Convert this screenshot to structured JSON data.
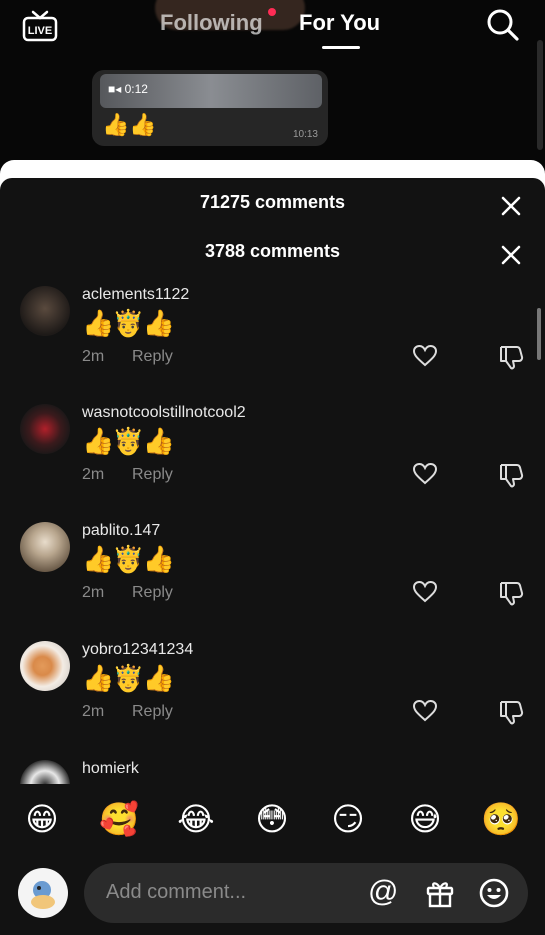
{
  "top_nav": {
    "live_label": "LIVE",
    "tabs": [
      {
        "label": "Following"
      },
      {
        "label": "For You"
      }
    ],
    "active_tab": "For You"
  },
  "chat_preview": {
    "duration": "0:12",
    "message": "👍👍",
    "time": "10:13"
  },
  "headers": [
    {
      "count_text": "71275 comments"
    },
    {
      "count_text": "3788 comments"
    }
  ],
  "comments": [
    {
      "username": "aclements1122",
      "text": "👍🤴👍",
      "time": "2m",
      "reply_label": "Reply"
    },
    {
      "username": "wasnotcoolstillnotcool2",
      "text": "👍🤴👍",
      "time": "2m",
      "reply_label": "Reply"
    },
    {
      "username": "pablito.147",
      "text": "👍🤴👍",
      "time": "2m",
      "reply_label": "Reply"
    },
    {
      "username": "yobro12341234",
      "text": "👍🤴👍",
      "time": "2m",
      "reply_label": "Reply"
    },
    {
      "username": "homierk"
    }
  ],
  "emoji_bar": [
    "😁",
    "🥰",
    "😂",
    "😳",
    "😏",
    "😅",
    "🥺"
  ],
  "input": {
    "placeholder": "Add comment..."
  },
  "colors": {
    "accent": "#fe2c55",
    "sheet_bg": "#121212",
    "muted": "#8a8a8a"
  }
}
